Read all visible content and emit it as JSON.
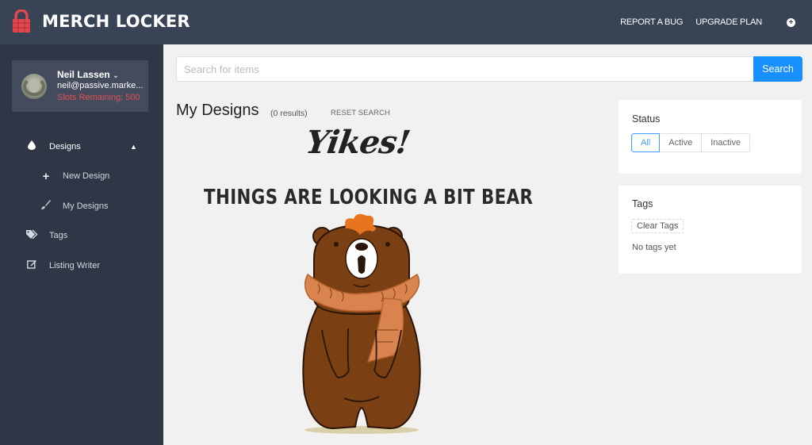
{
  "app": {
    "brand": "MERCH LOCKER",
    "brand_color": "#e2474e"
  },
  "topbar": {
    "links": [
      "REPORT A BUG",
      "UPGRADE PLAN"
    ],
    "add_icon": "plus-circle-icon"
  },
  "user": {
    "name": "Neil Lassen",
    "email": "neil@passive.marke...",
    "slots": "Slots Remaining: 500"
  },
  "sidebar": {
    "items": [
      {
        "label": "Designs",
        "icon": "droplet-icon",
        "expanded": true
      },
      {
        "label": "New Design",
        "icon": "plus-icon"
      },
      {
        "label": "My Designs",
        "icon": "paintbrush-icon"
      },
      {
        "label": "Tags",
        "icon": "tags-icon"
      },
      {
        "label": "Listing Writer",
        "icon": "edit-icon"
      }
    ]
  },
  "search": {
    "placeholder": "Search for items",
    "value": "",
    "button": "Search",
    "button_color": "#1890ff"
  },
  "main": {
    "title": "My Designs",
    "results": "(0 results)",
    "reset": "RESET SEARCH",
    "empty_heading": "Yikes!",
    "empty_subheading": "THINGS ARE LOOKING A BIT BEAR"
  },
  "status_panel": {
    "title": "Status",
    "options": [
      "All",
      "Active",
      "Inactive"
    ],
    "selected": "All"
  },
  "tags_panel": {
    "title": "Tags",
    "clear_label": "Clear Tags",
    "empty_text": "No tags yet"
  }
}
